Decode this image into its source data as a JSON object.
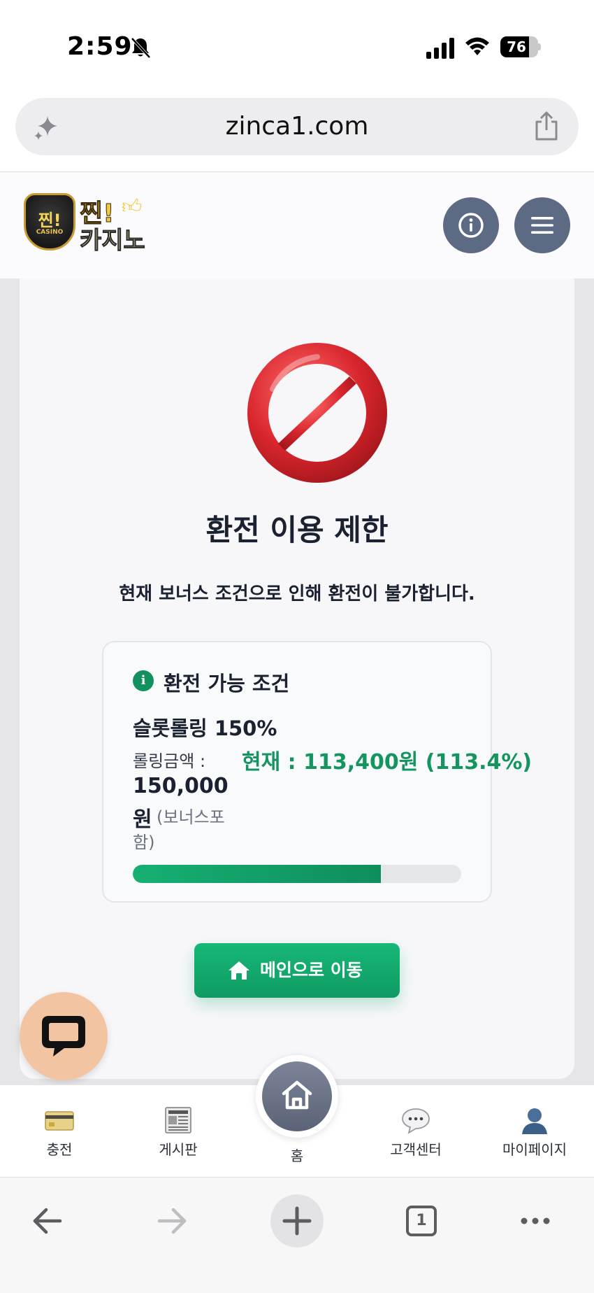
{
  "status": {
    "time": "2:59",
    "battery": "76",
    "battery_level": 0.76
  },
  "browser": {
    "url": "zinca1.com",
    "tab_count": "1"
  },
  "site": {
    "logo_word1": "찐!",
    "logo_word2": "카지노",
    "logo_badge": "찐!",
    "logo_badge_sub": "CASINO"
  },
  "notice": {
    "title": "환전 이용 제한",
    "message": "현재 보너스 조건으로 인해 환전이 불가합니다.",
    "condition_title": "환전 가능 조건",
    "rule": "슬롯롤링 150%",
    "rolling_label": "롤링금액 :",
    "rolling_amount": "150,000",
    "rolling_unit": "원",
    "rolling_note": "(보너스포함)",
    "current_text": "현재 : 113,400원 (113.4%)",
    "progress_fraction": 0.756,
    "info_glyph": "i",
    "main_button": "메인으로 이동"
  },
  "nav": {
    "items": [
      {
        "label": "충전",
        "icon": "credit-card-icon"
      },
      {
        "label": "게시판",
        "icon": "newspaper-icon"
      },
      {
        "label": "홈",
        "icon": "home-icon"
      },
      {
        "label": "고객센터",
        "icon": "speech-bubble-icon"
      },
      {
        "label": "마이페이지",
        "icon": "user-icon"
      }
    ]
  },
  "colors": {
    "accent_green": "#14945f",
    "header_button": "#5d6a83",
    "chat_fab": "#f3c4a2",
    "ban_red": "#d8262d"
  }
}
